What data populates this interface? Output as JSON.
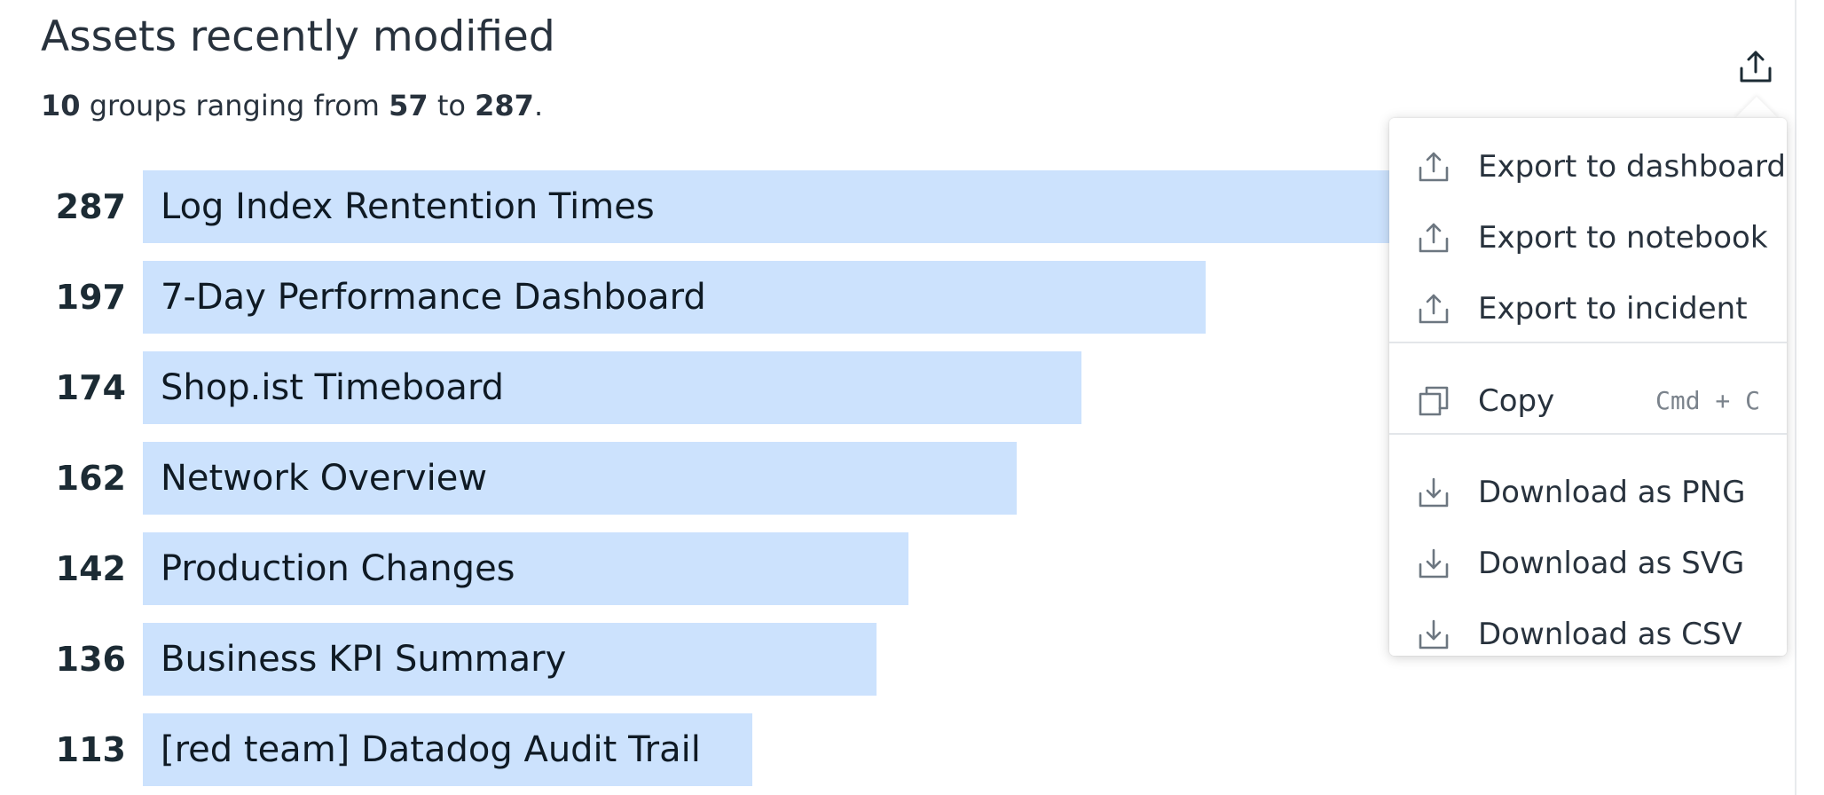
{
  "widget": {
    "title": "Assets recently modified",
    "summary": {
      "count": "10",
      "text_groups": " groups ranging from ",
      "min": "57",
      "text_to": " to ",
      "max": "287",
      "text_end": "."
    }
  },
  "chart_data": {
    "type": "bar",
    "orientation": "horizontal",
    "categories": [
      "Log Index Rentention Times",
      "7-Day Performance Dashboard",
      "Shop.ist Timeboard",
      "Network Overview",
      "Production Changes",
      "Business KPI Summary",
      "[red team] Datadog Audit Trail"
    ],
    "values": [
      287,
      197,
      174,
      162,
      142,
      136,
      113
    ],
    "labels": [
      "287",
      "197",
      "174",
      "162",
      "142",
      "136",
      "113"
    ],
    "bar_color": "#cce2fd"
  },
  "export_menu": {
    "items": [
      {
        "label": "Export to dashboard",
        "icon": "export-icon"
      },
      {
        "label": "Export to notebook",
        "icon": "export-icon"
      },
      {
        "label": "Export to incident",
        "icon": "export-icon"
      },
      {
        "label": "Copy",
        "icon": "copy-icon",
        "shortcut": "Cmd + C"
      },
      {
        "label": "Download as PNG",
        "icon": "download-icon"
      },
      {
        "label": "Download as SVG",
        "icon": "download-icon"
      },
      {
        "label": "Download as CSV",
        "icon": "download-icon"
      }
    ]
  },
  "colors": {
    "bar": "#cce2fd",
    "text": "#28323d",
    "muted": "#7b838c"
  }
}
